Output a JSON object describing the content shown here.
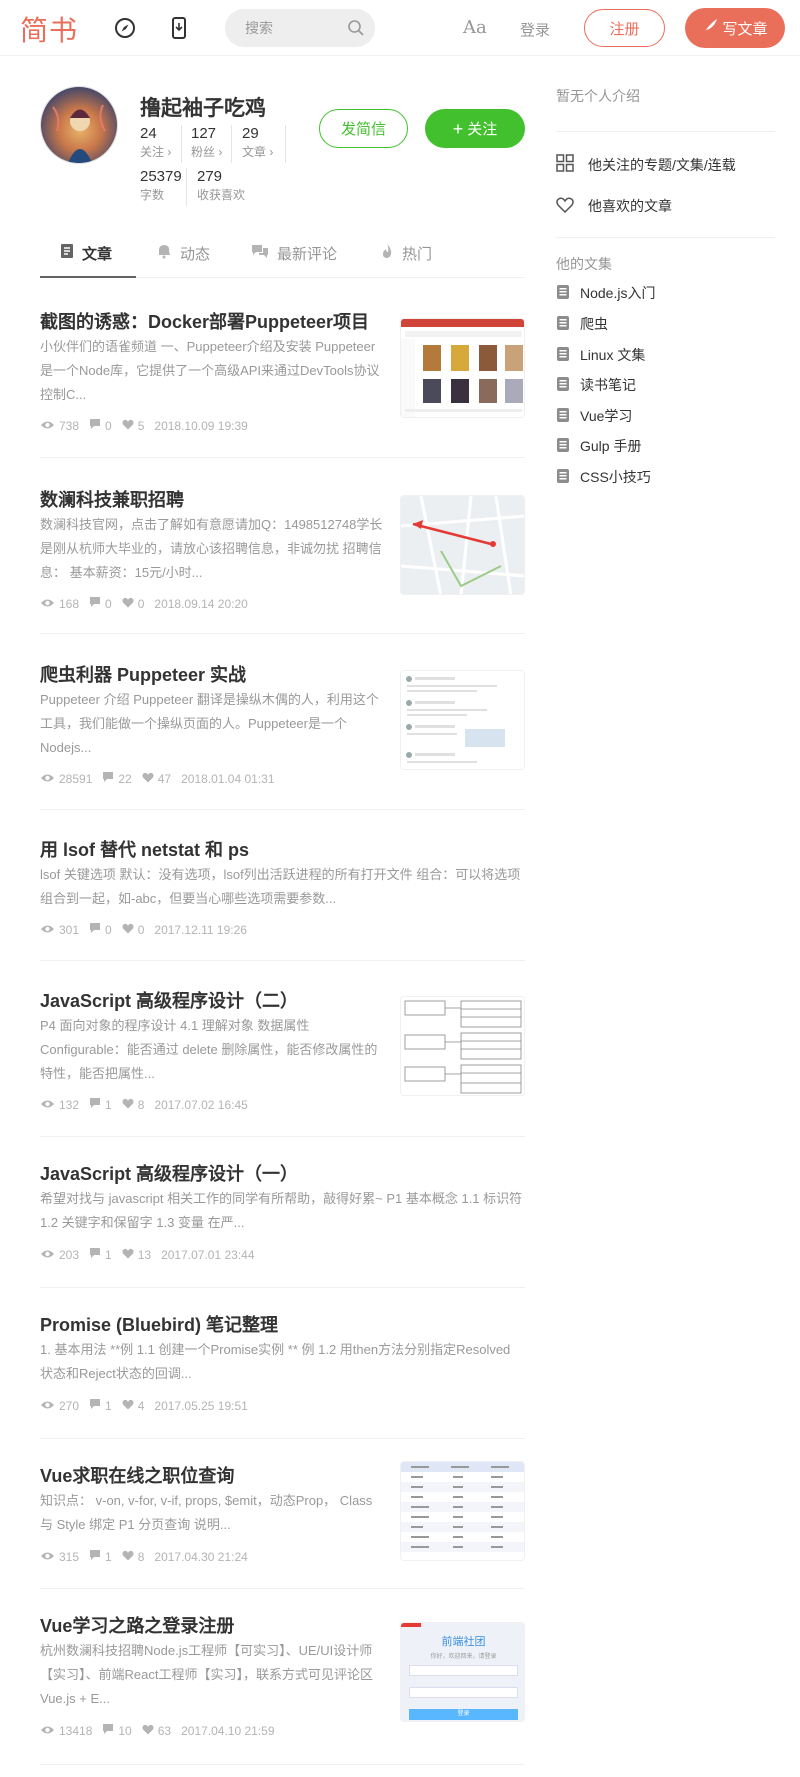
{
  "header": {
    "logo": "简书",
    "search_placeholder": "搜索",
    "font_toggle": "Aa",
    "login": "登录",
    "signup": "注册",
    "write": "写文章",
    "accent": "#ea6f5a"
  },
  "profile": {
    "name": "撸起袖子吃鸡",
    "stats": [
      {
        "num": "24",
        "label": "关注 ›"
      },
      {
        "num": "127",
        "label": "粉丝 ›"
      },
      {
        "num": "29",
        "label": "文章 ›"
      },
      {
        "num": "25379",
        "label": "字数"
      },
      {
        "num": "279",
        "label": "收获喜欢"
      }
    ],
    "message_btn": "发简信",
    "follow_btn": "关注",
    "follow_color": "#42c02e"
  },
  "tabs": [
    {
      "label": "文章",
      "icon": "document-icon",
      "active": true
    },
    {
      "label": "动态",
      "icon": "bell-icon",
      "active": false
    },
    {
      "label": "最新评论",
      "icon": "comments-icon",
      "active": false
    },
    {
      "label": "热门",
      "icon": "fire-icon",
      "active": false
    }
  ],
  "articles": [
    {
      "title": "截图的诱惑：Docker部署Puppeteer项目",
      "abstract": [
        "小伙伴们的语雀频道 一、Puppeteer介绍及安装 Puppeteer",
        "是一个Node库，它提供了一个高级API来通过DevTools协议",
        "控制C..."
      ],
      "views": "738",
      "comments": "0",
      "likes": "5",
      "date": "2018.10.09 19:39",
      "thumb": "screenshot-thumbnail"
    },
    {
      "title": "数澜科技兼职招聘",
      "abstract": [
        "数澜科技官网，点击了解如有意愿请加Q：1498512748学长",
        "是刚从杭师大毕业的，请放心该招聘信息，非诚勿扰 招聘信",
        "息： 基本薪资：15元/小时..."
      ],
      "views": "168",
      "comments": "0",
      "likes": "0",
      "date": "2018.09.14 20:20",
      "thumb": "map-thumbnail"
    },
    {
      "title": "爬虫利器 Puppeteer 实战",
      "abstract": [
        "Puppeteer 介绍 Puppeteer 翻译是操纵木偶的人，利用这个",
        "工具，我们能做一个操纵页面的人。Puppeteer是一个",
        "Nodejs..."
      ],
      "views": "28591",
      "comments": "22",
      "likes": "47",
      "date": "2018.01.04 01:31",
      "thumb": "feed-thumbnail"
    },
    {
      "title": "用 lsof 替代 netstat 和 ps",
      "abstract": [
        "lsof 关键选项 默认：没有选项，lsof列出活跃进程的所有打开文件 组合：可以将选项",
        "组合到一起，如-abc，但要当心哪些选项需要参数..."
      ],
      "views": "301",
      "comments": "0",
      "likes": "0",
      "date": "2017.12.11 19:26",
      "thumb": ""
    },
    {
      "title": "JavaScript 高级程序设计（二）",
      "abstract": [
        "P4 面向对象的程序设计 4.1 理解对象 数据属性",
        "Configurable：能否通过 delete 删除属性，能否修改属性的",
        "特性，能否把属性..."
      ],
      "views": "132",
      "comments": "1",
      "likes": "8",
      "date": "2017.07.02 16:45",
      "thumb": "diagram-thumbnail"
    },
    {
      "title": "JavaScript 高级程序设计（一）",
      "abstract": [
        "希望对找与 javascript 相关工作的同学有所帮助，敲得好累~ P1 基本概念 1.1 标识符",
        "1.2 关键字和保留字 1.3 变量 在严..."
      ],
      "views": "203",
      "comments": "1",
      "likes": "13",
      "date": "2017.07.01 23:44",
      "thumb": ""
    },
    {
      "title": "Promise (Bluebird) 笔记整理",
      "abstract": [
        "1. 基本用法 **例 1.1 创建一个Promise实例 ** 例 1.2 用then方法分别指定Resolved",
        "状态和Reject状态的回调..."
      ],
      "views": "270",
      "comments": "1",
      "likes": "4",
      "date": "2017.05.25 19:51",
      "thumb": ""
    },
    {
      "title": "Vue求职在线之职位查询",
      "abstract": [
        "知识点： v-on, v-for, v-if, props, $emit，动态Prop， Class",
        "与 Style 绑定 P1 分页查询 说明..."
      ],
      "views": "315",
      "comments": "1",
      "likes": "8",
      "date": "2017.04.30 21:24",
      "thumb": "table-thumbnail"
    },
    {
      "title": "Vue学习之路之登录注册",
      "abstract": [
        "杭州数澜科技招聘Node.js工程师【可实习】、UE/UI设计师",
        "【实习】、前端React工程师【实习】，联系方式可见评论区",
        "Vue.js + E..."
      ],
      "views": "13418",
      "comments": "10",
      "likes": "63",
      "date": "2017.04.10 21:59",
      "thumb": "login-form-thumbnail"
    }
  ],
  "thumb_text": {
    "login_title": "前端社团",
    "login_sub": "你好，欢迎回来，请登录",
    "login_btn": "登录"
  },
  "sidebar": {
    "intro": "暂无个人介绍",
    "followed": "他关注的专题/文集/连载",
    "liked": "他喜欢的文章",
    "notebooks_title": "他的文集",
    "notebooks": [
      "Node.js入门",
      "爬虫",
      "Linux 文集",
      "读书笔记",
      "Vue学习",
      "Gulp 手册",
      "CSS小技巧"
    ]
  }
}
